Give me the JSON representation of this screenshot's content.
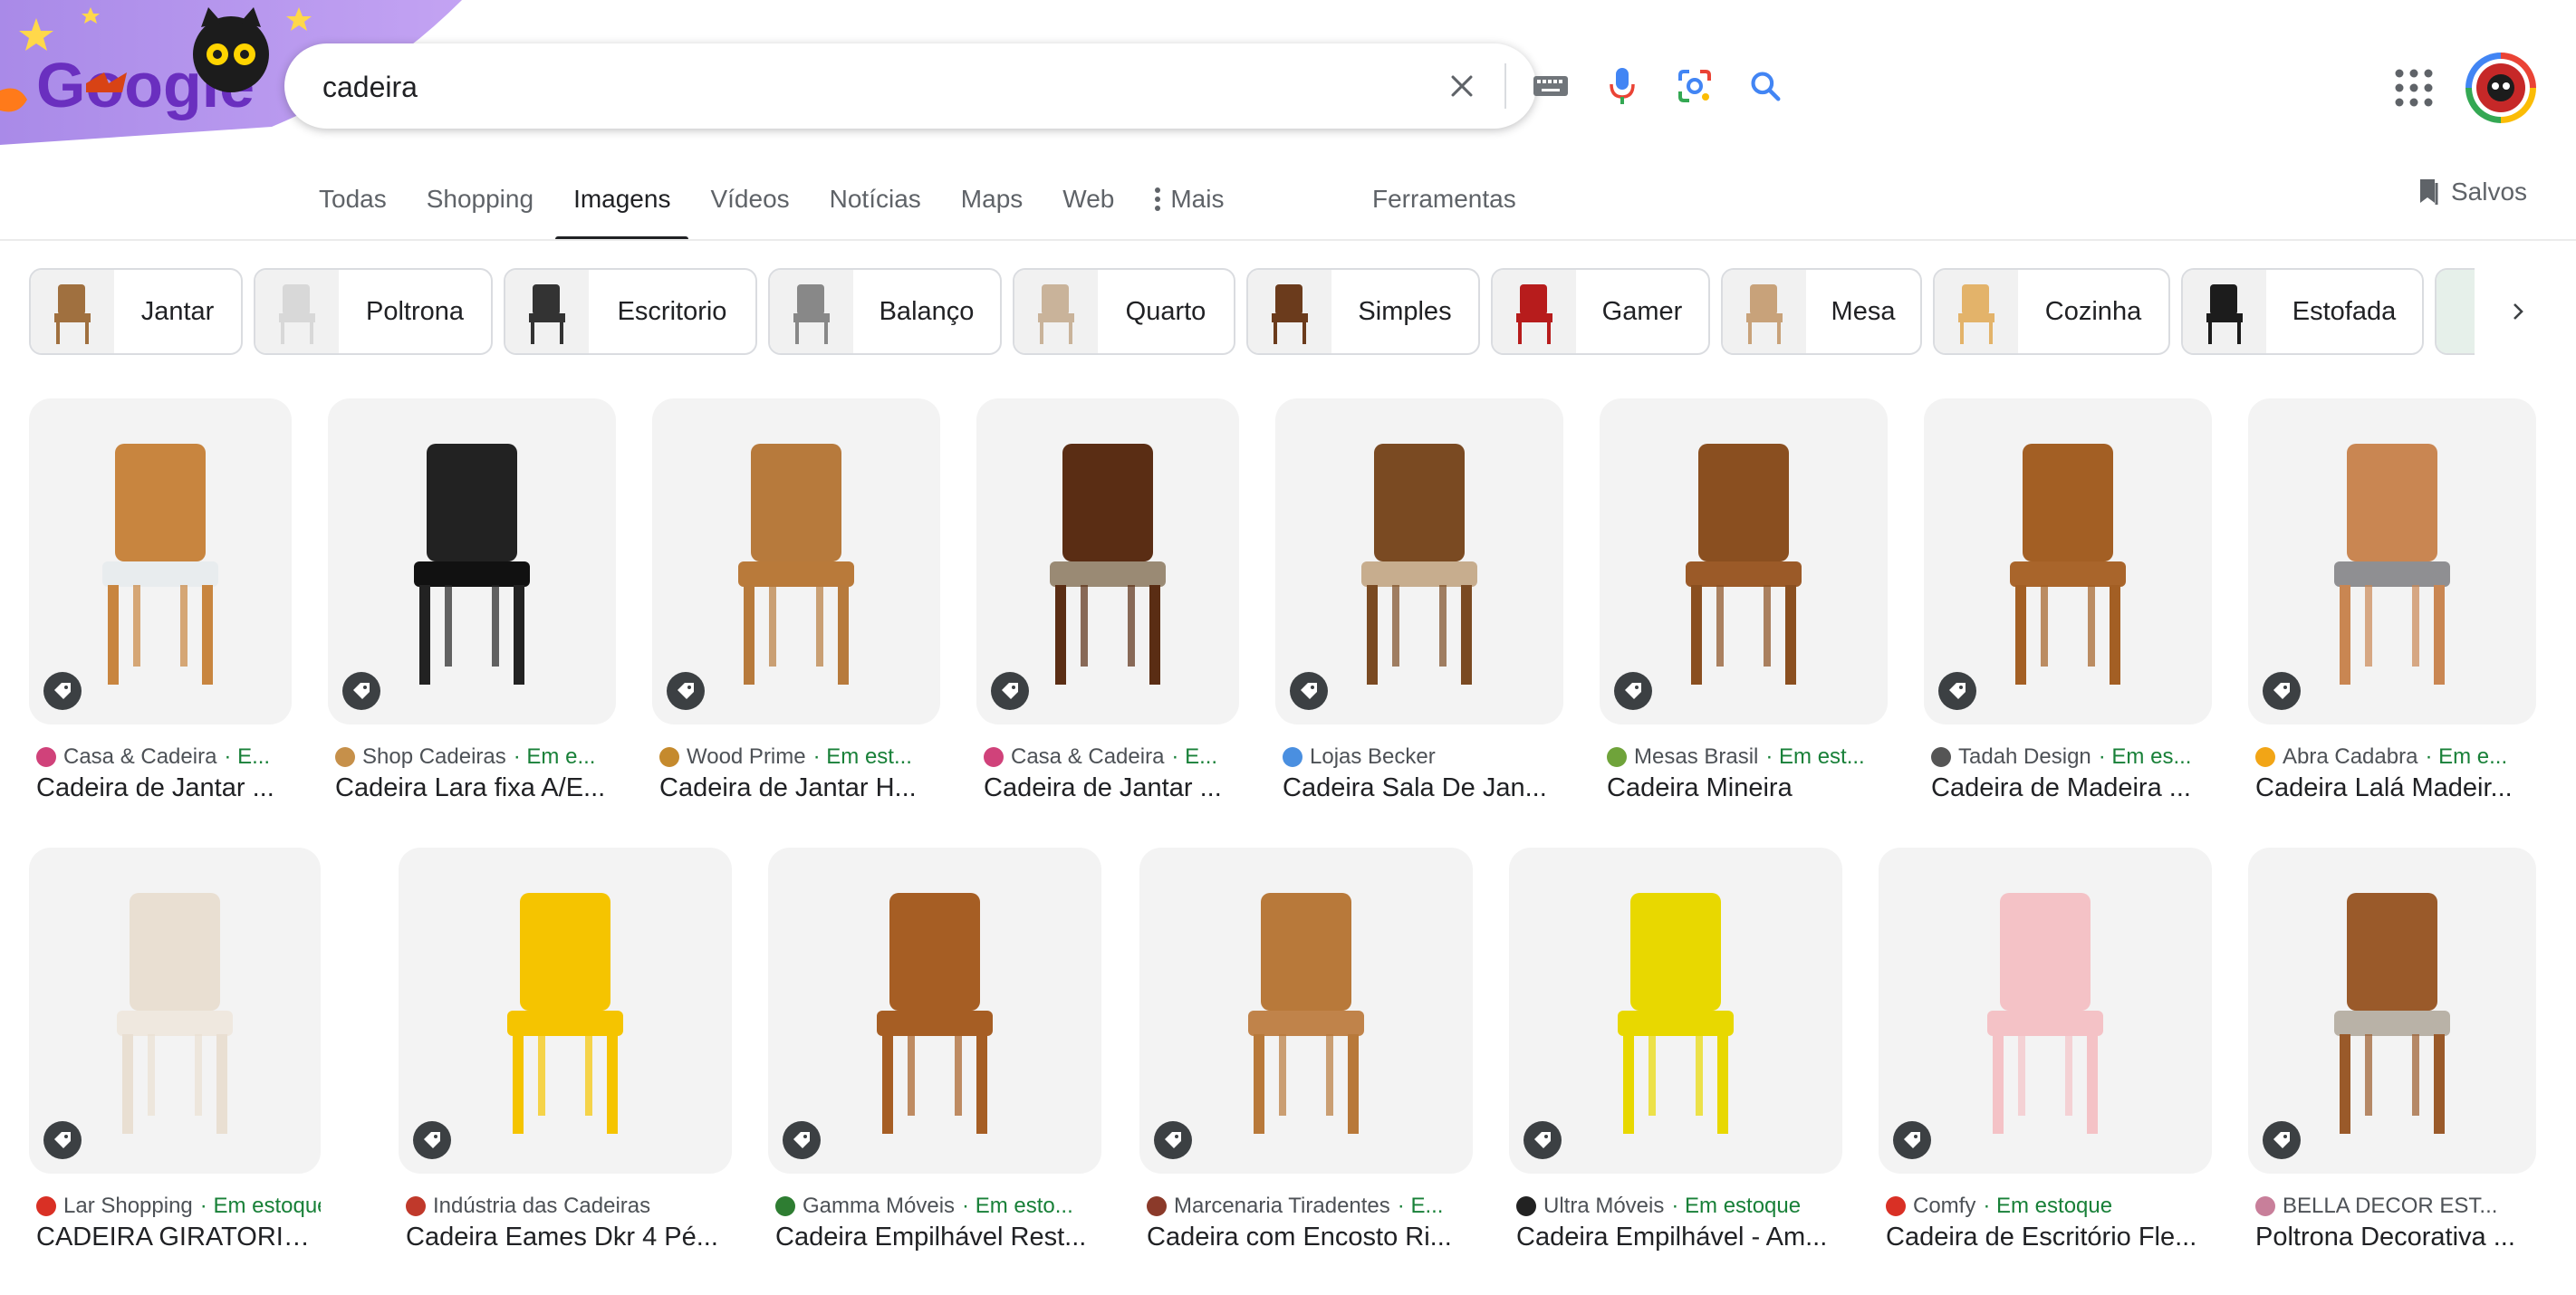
{
  "search": {
    "query": "cadeira",
    "logo_text": "Google"
  },
  "tabs": [
    {
      "label": "Todas",
      "active": false
    },
    {
      "label": "Shopping",
      "active": false
    },
    {
      "label": "Imagens",
      "active": true
    },
    {
      "label": "Vídeos",
      "active": false
    },
    {
      "label": "Notícias",
      "active": false
    },
    {
      "label": "Maps",
      "active": false
    },
    {
      "label": "Web",
      "active": false
    },
    {
      "label": "Mais",
      "active": false
    }
  ],
  "tools_label": "Ferramentas",
  "saved_label": "Salvos",
  "chips": [
    "Jantar",
    "Poltrona",
    "Escritorio",
    "Balanço",
    "Quarto",
    "Simples",
    "Gamer",
    "Mesa",
    "Cozinha",
    "Estofada"
  ],
  "results": [
    {
      "source": "Casa & Cadeira",
      "stock": "· E...",
      "title": "Cadeira de Jantar ...",
      "color": "#c8853f",
      "seat": "#e8ecee",
      "icon": "#d0427a"
    },
    {
      "source": "Shop Cadeiras",
      "stock": "· Em e...",
      "title": "Cadeira Lara fixa A/E...",
      "color": "#222222",
      "seat": "#111111",
      "icon": "#c6904a"
    },
    {
      "source": "Wood Prime",
      "stock": "· Em est...",
      "title": "Cadeira de Jantar H...",
      "color": "#b77a3c",
      "seat": "#b97a3a",
      "icon": "#c58a2d"
    },
    {
      "source": "Casa & Cadeira",
      "stock": "· E...",
      "title": "Cadeira de Jantar ...",
      "color": "#5a2d14",
      "seat": "#9a8a74",
      "icon": "#d0427a"
    },
    {
      "source": "Lojas Becker",
      "stock": "",
      "title": "Cadeira Sala De Jan...",
      "color": "#7a4a22",
      "seat": "#c7ad8e",
      "icon": "#4a8fe0"
    },
    {
      "source": "Mesas Brasil",
      "stock": "· Em est...",
      "title": "Cadeira Mineira",
      "color": "#8a4f20",
      "seat": "#9b5a28",
      "icon": "#6fa33a"
    },
    {
      "source": "Tadah Design",
      "stock": "· Em es...",
      "title": "Cadeira de Madeira ...",
      "color": "#a35f24",
      "seat": "#a9652b",
      "icon": "#555555"
    },
    {
      "source": "Abra Cadabra",
      "stock": "· Em e...",
      "title": "Cadeira Lalá Madeir...",
      "color": "#c98652",
      "seat": "#8f8f92",
      "icon": "#f2a516"
    },
    {
      "source": "Lar Shopping",
      "stock": "· Em estoque",
      "title": "CADEIRA GIRATORIA M...",
      "color": "#e9dfd2",
      "seat": "#efe8df",
      "icon": "#d93025"
    },
    {
      "source": "Indústria das Cadeiras",
      "stock": "",
      "title": "Cadeira Eames Dkr 4 Pé...",
      "color": "#f5c400",
      "seat": "#f5c400",
      "icon": "#c0392b"
    },
    {
      "source": "Gamma Móveis",
      "stock": "· Em esto...",
      "title": "Cadeira Empilhável Rest...",
      "color": "#a65e24",
      "seat": "#a65e24",
      "icon": "#2e7d32"
    },
    {
      "source": "Marcenaria Tiradentes",
      "stock": "· E...",
      "title": "Cadeira com Encosto Ri...",
      "color": "#b8793a",
      "seat": "#c0834a",
      "icon": "#8b3a2a"
    },
    {
      "source": "Ultra Móveis",
      "stock": "· Em estoque",
      "title": "Cadeira Empilhável - Am...",
      "color": "#e8d800",
      "seat": "#e8d800",
      "icon": "#222222"
    },
    {
      "source": "Comfy",
      "stock": "· Em estoque",
      "title": "Cadeira de Escritório Fle...",
      "color": "#f4c2c6",
      "seat": "#f4c2c6",
      "icon": "#d93025"
    },
    {
      "source": "BELLA DECOR EST...",
      "stock": "",
      "title": "Poltrona Decorativa ...",
      "color": "#9a5a2a",
      "seat": "#b9b2a7",
      "icon": "#c87f9a"
    }
  ],
  "colors": {
    "accent_blue": "#4285f4",
    "stock_green": "#188038",
    "doodle_purple": "#b98ff0"
  }
}
